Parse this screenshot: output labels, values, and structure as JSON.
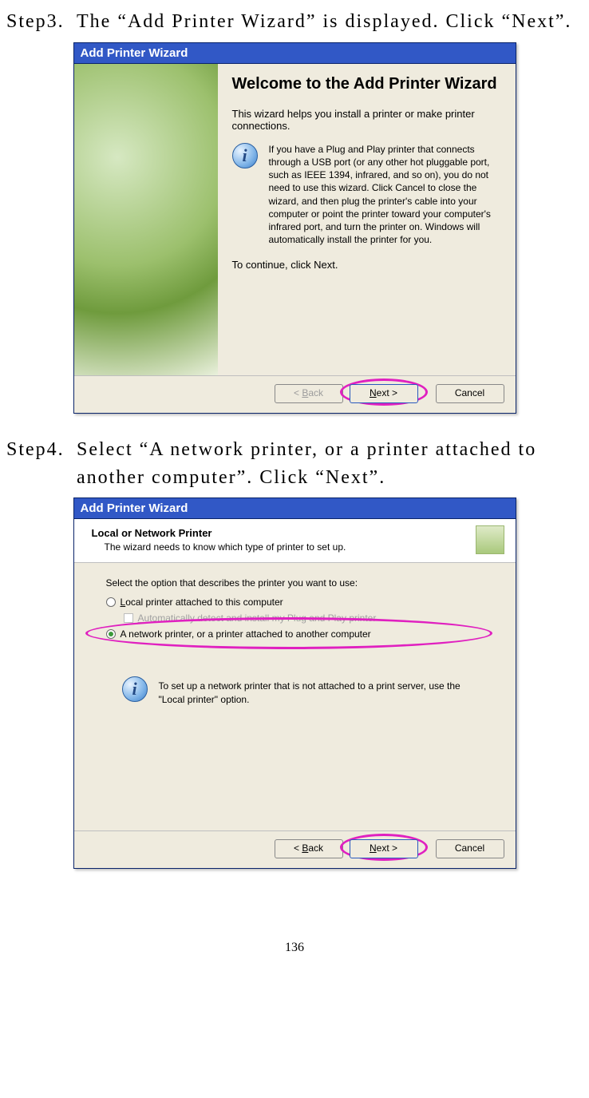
{
  "step3": {
    "label": "Step3.",
    "text": "The “Add Printer Wizard” is displayed. Click “Next”."
  },
  "step4": {
    "label": "Step4.",
    "text": "Select “A network printer, or a printer attached to another computer”. Click “Next”."
  },
  "dialog1": {
    "title": "Add Printer Wizard",
    "welcome": "Welcome to the Add Printer Wizard",
    "intro": "This wizard helps you install a printer or make printer connections.",
    "info_icon": "i",
    "info_text": "If you have a Plug and Play printer that connects through a USB port (or any other hot pluggable port, such as IEEE 1394, infrared, and so on), you do not need to use this wizard. Click Cancel to close the wizard, and then plug the printer's cable into your computer or point the printer toward your computer's infrared port, and turn the printer on. Windows will automatically install the printer for you.",
    "continue_text": "To continue, click Next.",
    "back": "< Back",
    "back_accel": "B",
    "next": "Next >",
    "next_accel": "N",
    "cancel": "Cancel"
  },
  "dialog2": {
    "title": "Add Printer Wizard",
    "header_title": "Local or Network Printer",
    "header_sub": "The wizard needs to know which type of printer to set up.",
    "prompt": "Select the option that describes the printer you want to use:",
    "opt_local": "Local printer attached to this computer",
    "opt_local_accel": "L",
    "opt_auto": "Automatically detect and install my Plug and Play printer",
    "opt_auto_accel": "A",
    "opt_network": "A network printer, or a printer attached to another computer",
    "info_icon": "i",
    "note": "To set up a network printer that is not attached to a print server, use the \"Local printer\" option.",
    "back": "< Back",
    "back_accel": "B",
    "next": "Next >",
    "next_accel": "N",
    "cancel": "Cancel"
  },
  "page_number": "136"
}
